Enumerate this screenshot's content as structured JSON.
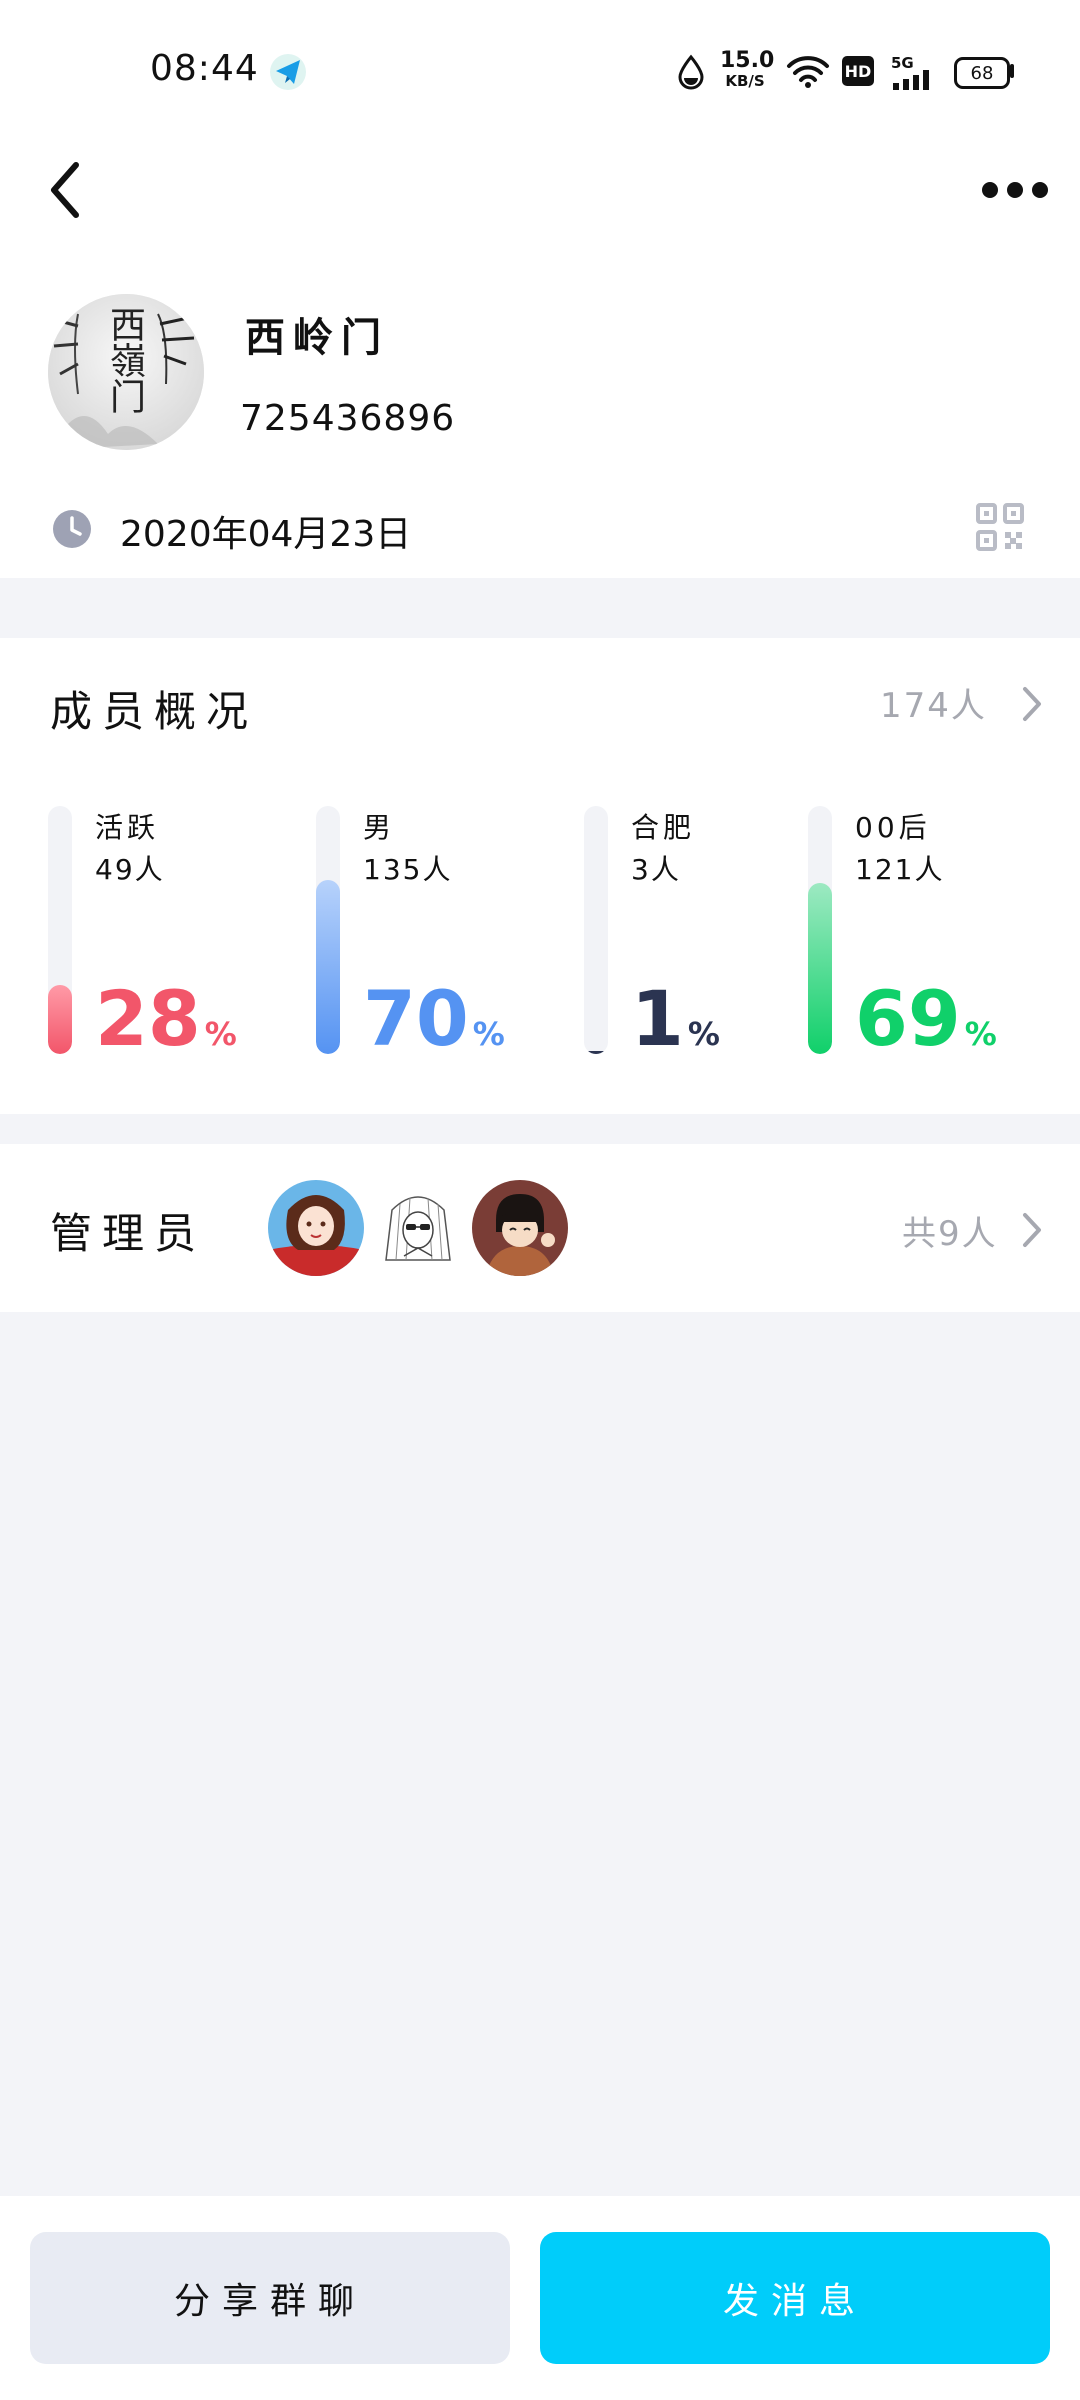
{
  "status_bar": {
    "time": "08:44",
    "net_speed_value": "15.0",
    "net_speed_unit": "KB/S",
    "hd_label": "HD",
    "signal_label": "5G",
    "battery": "68",
    "icons": [
      "telegram-icon",
      "drop-icon",
      "wifi-icon",
      "hd-icon",
      "signal-icon",
      "battery-icon"
    ]
  },
  "header": {
    "back_icon": "chevron-left-icon",
    "more_icon": "more-dots-icon"
  },
  "group": {
    "name": "西岭门",
    "id": "725436896",
    "created_date": "2020年04月23日",
    "avatar_text": "西嶺门"
  },
  "overview": {
    "title": "成员概况",
    "total": "174人",
    "stats": [
      {
        "label": "活跃",
        "count": "49人",
        "percent": "28",
        "unit": "%",
        "fraction": 0.28,
        "color": "#f2566a",
        "color_light": "#ff9aa7"
      },
      {
        "label": "男",
        "count": "135人",
        "percent": "70",
        "unit": "%",
        "fraction": 0.7,
        "color": "#5593f2",
        "color_light": "#b7d2fb"
      },
      {
        "label": "合肥",
        "count": "3人",
        "percent": "1",
        "unit": "%",
        "fraction": 0.01,
        "color": "#2b3451",
        "color_light": "#2b3451"
      },
      {
        "label": "00后",
        "count": "121人",
        "percent": "69",
        "unit": "%",
        "fraction": 0.69,
        "color": "#10d06a",
        "color_light": "#9de9c2"
      }
    ]
  },
  "admins": {
    "title": "管理员",
    "total": "共9人"
  },
  "buttons": {
    "share": "分享群聊",
    "message": "发消息"
  },
  "colors": {
    "accent": "#00cdfa",
    "background": "#f3f4f8"
  }
}
